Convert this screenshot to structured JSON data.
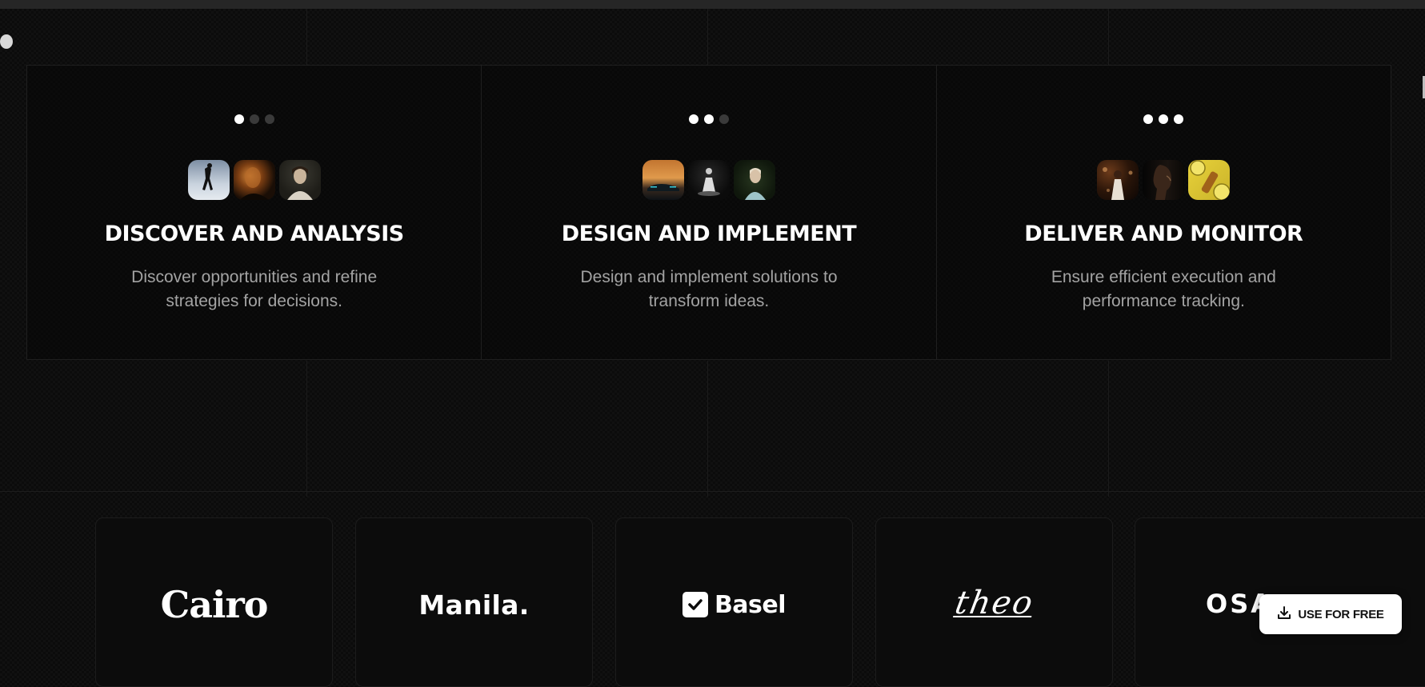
{
  "steps": [
    {
      "title": "DISCOVER AND ANALYSIS",
      "description": "Discover opportunities and refine strategies for decisions.",
      "active_dots": 1,
      "thumbs": [
        "walking-figure-photo",
        "lit-face-photo",
        "portrait-photo"
      ]
    },
    {
      "title": "DESIGN AND IMPLEMENT",
      "description": "Design and implement solutions to transform ideas.",
      "active_dots": 2,
      "thumbs": [
        "sunset-car-photo",
        "seated-figure-photo",
        "greenery-portrait-photo"
      ]
    },
    {
      "title": "DELIVER AND MONITOR",
      "description": "Ensure efficient execution and performance tracking.",
      "active_dots": 3,
      "thumbs": [
        "bokeh-figure-photo",
        "profile-portrait-photo",
        "citrus-bottle-photo"
      ]
    }
  ],
  "logos": {
    "cairo": "Cairo",
    "manila": "Manila.",
    "basel": "Basel",
    "theo": "theo",
    "osaka_partial": "OSA"
  },
  "cta": {
    "label": "USE FOR FREE",
    "icon": "download-icon"
  },
  "colors": {
    "background": "#0a0a0a",
    "text_primary": "#ffffff",
    "text_secondary": "#a3a3a3",
    "dot_inactive": "#3a3a3a"
  }
}
